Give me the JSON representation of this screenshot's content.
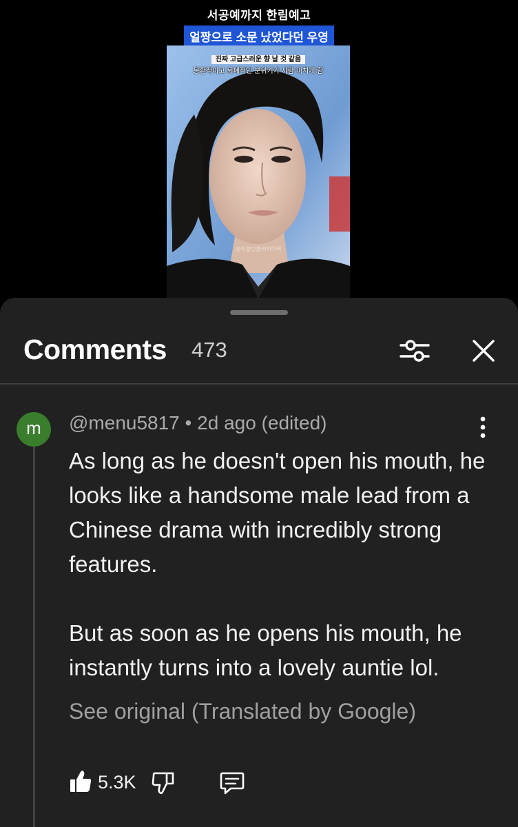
{
  "video": {
    "caption_line1": "서공예까지 한림예고",
    "caption_line2": "얼짱으로 소문 났었다던 우영",
    "frame_caption1": "진짜 고급스러운 향 날 것 같음",
    "frame_caption2": "몽환적이고 퇴폐적인 분위기가 사람 미치게 함",
    "watermark": "@이블린블리지이비",
    "colors": {
      "caption_highlight": "#1e56d6",
      "sky": "#7aa6d9"
    }
  },
  "comments_panel": {
    "title": "Comments",
    "count": "473",
    "filter_icon": "sliders-icon",
    "close_icon": "close-icon"
  },
  "comment": {
    "avatar_letter": "m",
    "avatar_color": "#3a7d2d",
    "author": "@menu5817",
    "separator": "•",
    "time": "2d ago (edited)",
    "paragraph1": "As long as he doesn't open his mouth, he looks like a handsome male lead from a Chinese drama with incredibly strong features.",
    "paragraph2": "But as soon as he opens his mouth, he instantly turns into a lovely auntie lol.",
    "see_original": "See original (Translated by Google)",
    "likes": "5.3K",
    "icons": [
      "thumbs-up-icon",
      "thumbs-down-icon",
      "reply-icon",
      "more-vert-icon"
    ]
  }
}
